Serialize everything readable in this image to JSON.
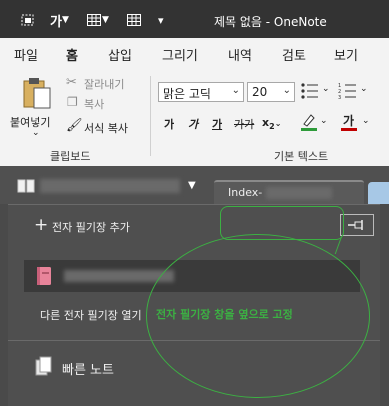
{
  "titlebar": {
    "title": "제목 없음  -  OneNote",
    "format_glyph": "가"
  },
  "tabs": [
    "파일",
    "홈",
    "삽입",
    "그리기",
    "내역",
    "검토",
    "보기"
  ],
  "ribbon": {
    "clipboard": {
      "paste_label": "붙여넣기",
      "cut_label": "잘라내기",
      "copy_label": "복사",
      "format_painter_label": "서식 복사",
      "group_label": "클립보드"
    },
    "basic_text": {
      "font_name": "맑은 고딕",
      "font_size": "20",
      "bold": "가",
      "italic": "가",
      "underline": "가",
      "strike": "가가",
      "subscript": "x",
      "subscript_sub": "2",
      "font_color_glyph": "가",
      "group_label": "기본 텍스트"
    },
    "colors": {
      "highlight": "#2e9b3a",
      "font_color": "#c00000",
      "accent_tab": "#7a3fa0"
    }
  },
  "notebook_bar": {
    "page_tab_label": "Index-"
  },
  "pane": {
    "add_notebook_label": "전자 필기장 추가",
    "other_notebooks_label": "다른 전자 필기장 열기",
    "annotation_label": "전자 필기장 창을 옆으로 고정",
    "quick_notes_label": "빠른 노트",
    "annotation_color": "#3cb043"
  }
}
